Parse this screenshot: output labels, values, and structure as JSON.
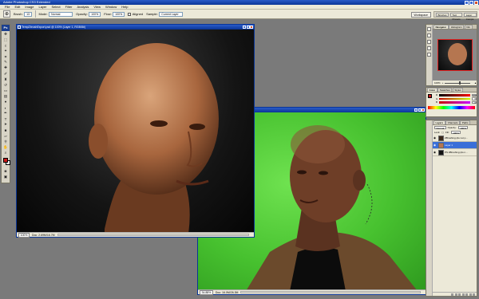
{
  "app": {
    "title": "Adobe Photoshop CS3 Extended"
  },
  "menu": [
    "File",
    "Edit",
    "Image",
    "Layer",
    "Select",
    "Filter",
    "Analysis",
    "View",
    "Window",
    "Help"
  ],
  "options_bar": {
    "brush_label": "Brush:",
    "brush_value": "13",
    "mode_label": "Mode:",
    "mode_value": "Normal",
    "opacity_label": "Opacity:",
    "opacity_value": "100%",
    "flow_label": "Flow:",
    "flow_value": "100%",
    "aligned_label": "Aligned",
    "sample_label": "Sample:",
    "sample_value": "Current Layer",
    "workspace_label": "Workspace"
  },
  "palette_well": [
    "Brushes",
    "Tool Presets",
    "Layer Comps"
  ],
  "toolbox": {
    "logo": "Ps",
    "tool_icons": [
      "move-icon",
      "marquee-icon",
      "lasso-icon",
      "magic-wand-icon",
      "crop-icon",
      "slice-icon",
      "healing-icon",
      "brush-icon",
      "clone-stamp-icon",
      "history-brush-icon",
      "eraser-icon",
      "gradient-icon",
      "blur-icon",
      "dodge-icon",
      "pen-icon",
      "type-icon",
      "path-select-icon",
      "shape-icon",
      "notes-icon",
      "eyedropper-icon",
      "hand-icon",
      "zoom-icon"
    ],
    "foreground_color": "#c81818",
    "background_color": "#ffffff"
  },
  "doc_left": {
    "title": "TempZbrushExport.psd @ 100% (Layer 1, RGB/8#)",
    "zoom": "100%",
    "info": "Doc: 2.69M/16.7M"
  },
  "doc_right": {
    "title": "",
    "zoom": "34.88%",
    "info": "Doc: 16.0M/26.3M"
  },
  "navigator_panel": {
    "tabs": [
      "Navigator",
      "Histogram",
      "Info"
    ],
    "zoom": "100%"
  },
  "color_panel": {
    "tabs": [
      "Color",
      "Swatches",
      "Styles"
    ],
    "channels": [
      {
        "label": "R",
        "value": "200"
      },
      {
        "label": "G",
        "value": "0"
      },
      {
        "label": "B",
        "value": "0"
      }
    ]
  },
  "layers_panel": {
    "tabs": [
      "Layers",
      "Channels",
      "Paths"
    ],
    "blend_mode": "Normal",
    "opacity_label": "Opacity:",
    "opacity_value": "100%",
    "lock_label": "Lock:",
    "fill_label": "Fill:",
    "fill_value": "100%",
    "layers": [
      {
        "name": "ZBrushing (do not p...",
        "selected": false
      },
      {
        "name": "Layer 1",
        "selected": true
      },
      {
        "name": "PS ZBrushing (do n...",
        "selected": false
      }
    ]
  },
  "colors": {
    "title_blue": "#0a3597",
    "chrome": "#ece9d8",
    "selection": "#3a6fd8",
    "green_screen": "#47c12f"
  }
}
